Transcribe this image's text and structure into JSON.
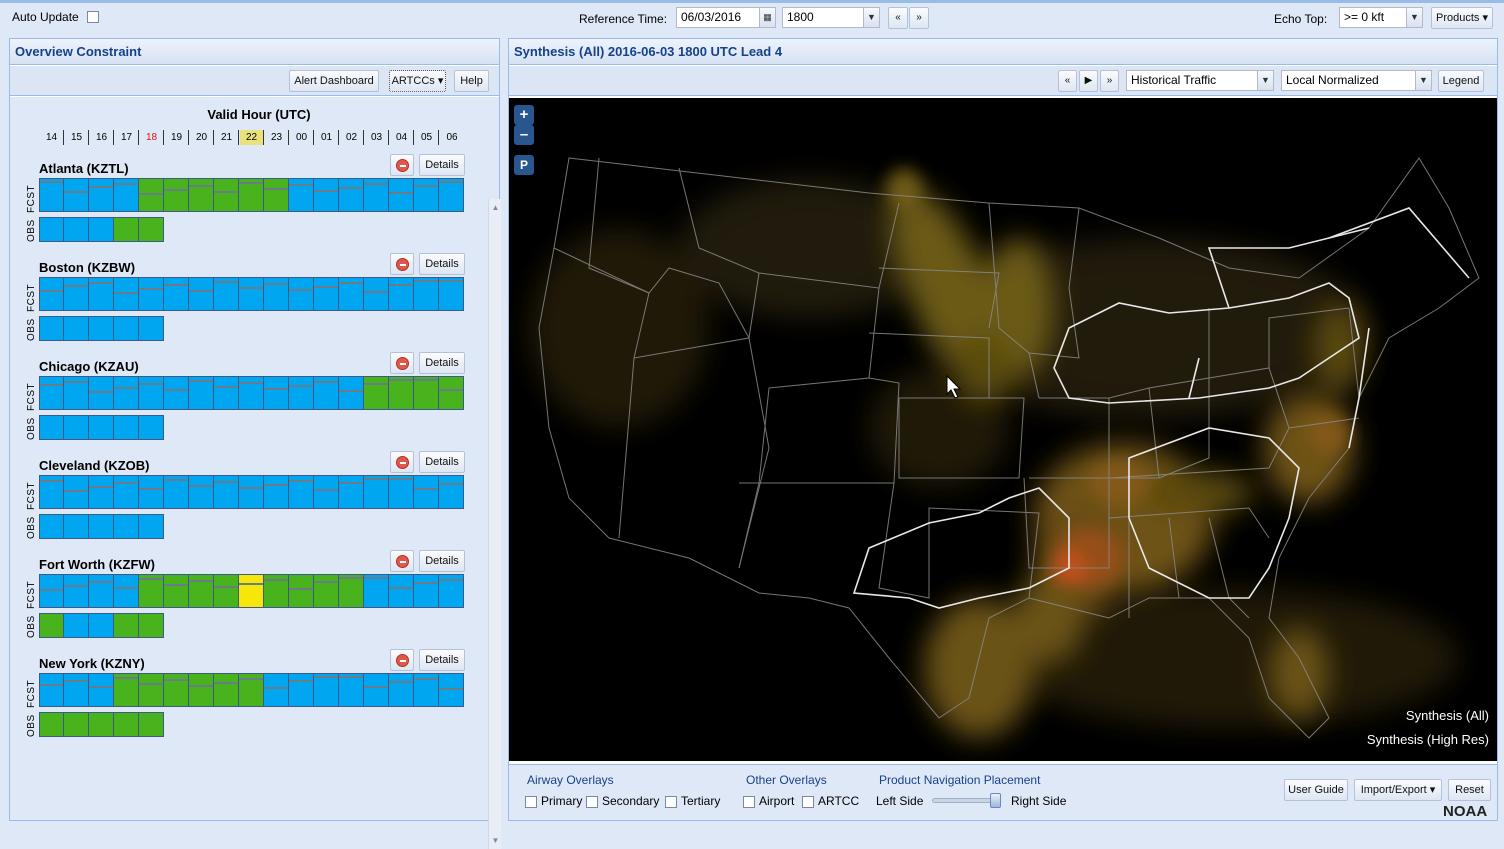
{
  "topbar": {
    "auto_update_label": "Auto Update",
    "reference_time_label": "Reference Time:",
    "reference_date": "06/03/2016",
    "reference_hour": "1800",
    "echo_top_label": "Echo Top:",
    "echo_top_value": ">= 0 kft",
    "products_label": "Products"
  },
  "left_panel": {
    "title": "Overview Constraint",
    "buttons": {
      "alert_dashboard": "Alert Dashboard",
      "artccs": "ARTCCs",
      "help": "Help"
    },
    "valid_hour_label": "Valid Hour (UTC)",
    "hours": [
      "14",
      "15",
      "16",
      "17",
      "18",
      "19",
      "20",
      "21",
      "22",
      "23",
      "00",
      "01",
      "02",
      "03",
      "04",
      "05",
      "06"
    ],
    "current_hour": "18",
    "selected_hour": "22",
    "fcst_label": "FCST",
    "obs_label": "OBS",
    "details_label": "Details",
    "colors": {
      "b": "#00a6f0",
      "g": "#48b31c",
      "y": "#f6e60a"
    },
    "artccs": [
      {
        "name": "Atlanta (KZTL)",
        "fcst": [
          "b",
          "b",
          "b",
          "b",
          "g",
          "g",
          "g",
          "g",
          "g",
          "g",
          "b",
          "b",
          "b",
          "b",
          "b",
          "b",
          "b"
        ],
        "obs": [
          "b",
          "b",
          "b",
          "g",
          "g"
        ]
      },
      {
        "name": "Boston (KZBW)",
        "fcst": [
          "b",
          "b",
          "b",
          "b",
          "b",
          "b",
          "b",
          "b",
          "b",
          "b",
          "b",
          "b",
          "b",
          "b",
          "b",
          "b",
          "b"
        ],
        "obs": [
          "b",
          "b",
          "b",
          "b",
          "b"
        ]
      },
      {
        "name": "Chicago (KZAU)",
        "fcst": [
          "b",
          "b",
          "b",
          "b",
          "b",
          "b",
          "b",
          "b",
          "b",
          "b",
          "b",
          "b",
          "b",
          "g",
          "g",
          "g",
          "g"
        ],
        "obs": [
          "b",
          "b",
          "b",
          "b",
          "b"
        ]
      },
      {
        "name": "Cleveland (KZOB)",
        "fcst": [
          "b",
          "b",
          "b",
          "b",
          "b",
          "b",
          "b",
          "b",
          "b",
          "b",
          "b",
          "b",
          "b",
          "b",
          "b",
          "b",
          "b"
        ],
        "obs": [
          "b",
          "b",
          "b",
          "b",
          "b"
        ]
      },
      {
        "name": "Fort Worth (KZFW)",
        "fcst": [
          "b",
          "b",
          "b",
          "b",
          "g",
          "g",
          "g",
          "g",
          "y",
          "g",
          "g",
          "g",
          "g",
          "b",
          "b",
          "b",
          "b"
        ],
        "obs": [
          "g",
          "b",
          "b",
          "g",
          "g"
        ]
      },
      {
        "name": "New York (KZNY)",
        "fcst": [
          "b",
          "b",
          "b",
          "g",
          "g",
          "g",
          "g",
          "g",
          "g",
          "b",
          "b",
          "b",
          "b",
          "b",
          "b",
          "b",
          "b"
        ],
        "obs": [
          "g",
          "g",
          "g",
          "g",
          "g"
        ]
      }
    ]
  },
  "right_panel": {
    "title": "Synthesis (All) 2016-06-03 1800 UTC Lead 4",
    "traffic_select": "Historical Traffic",
    "normalize_select": "Local Normalized",
    "legend_button": "Legend",
    "zoom_in": "+",
    "zoom_out": "–",
    "p_button": "P",
    "map_labels": [
      "Synthesis (All)",
      "Synthesis (High Res)"
    ]
  },
  "bottom": {
    "airway_overlays_label": "Airway Overlays",
    "airway_options": [
      "Primary",
      "Secondary",
      "Tertiary"
    ],
    "other_overlays_label": "Other Overlays",
    "other_options": [
      "Airport",
      "ARTCC"
    ],
    "nav_placement_label": "Product Navigation Placement",
    "left_side": "Left Side",
    "right_side": "Right Side",
    "user_guide": "User Guide",
    "import_export": "Import/Export",
    "reset": "Reset",
    "noaa": "NOAA"
  }
}
